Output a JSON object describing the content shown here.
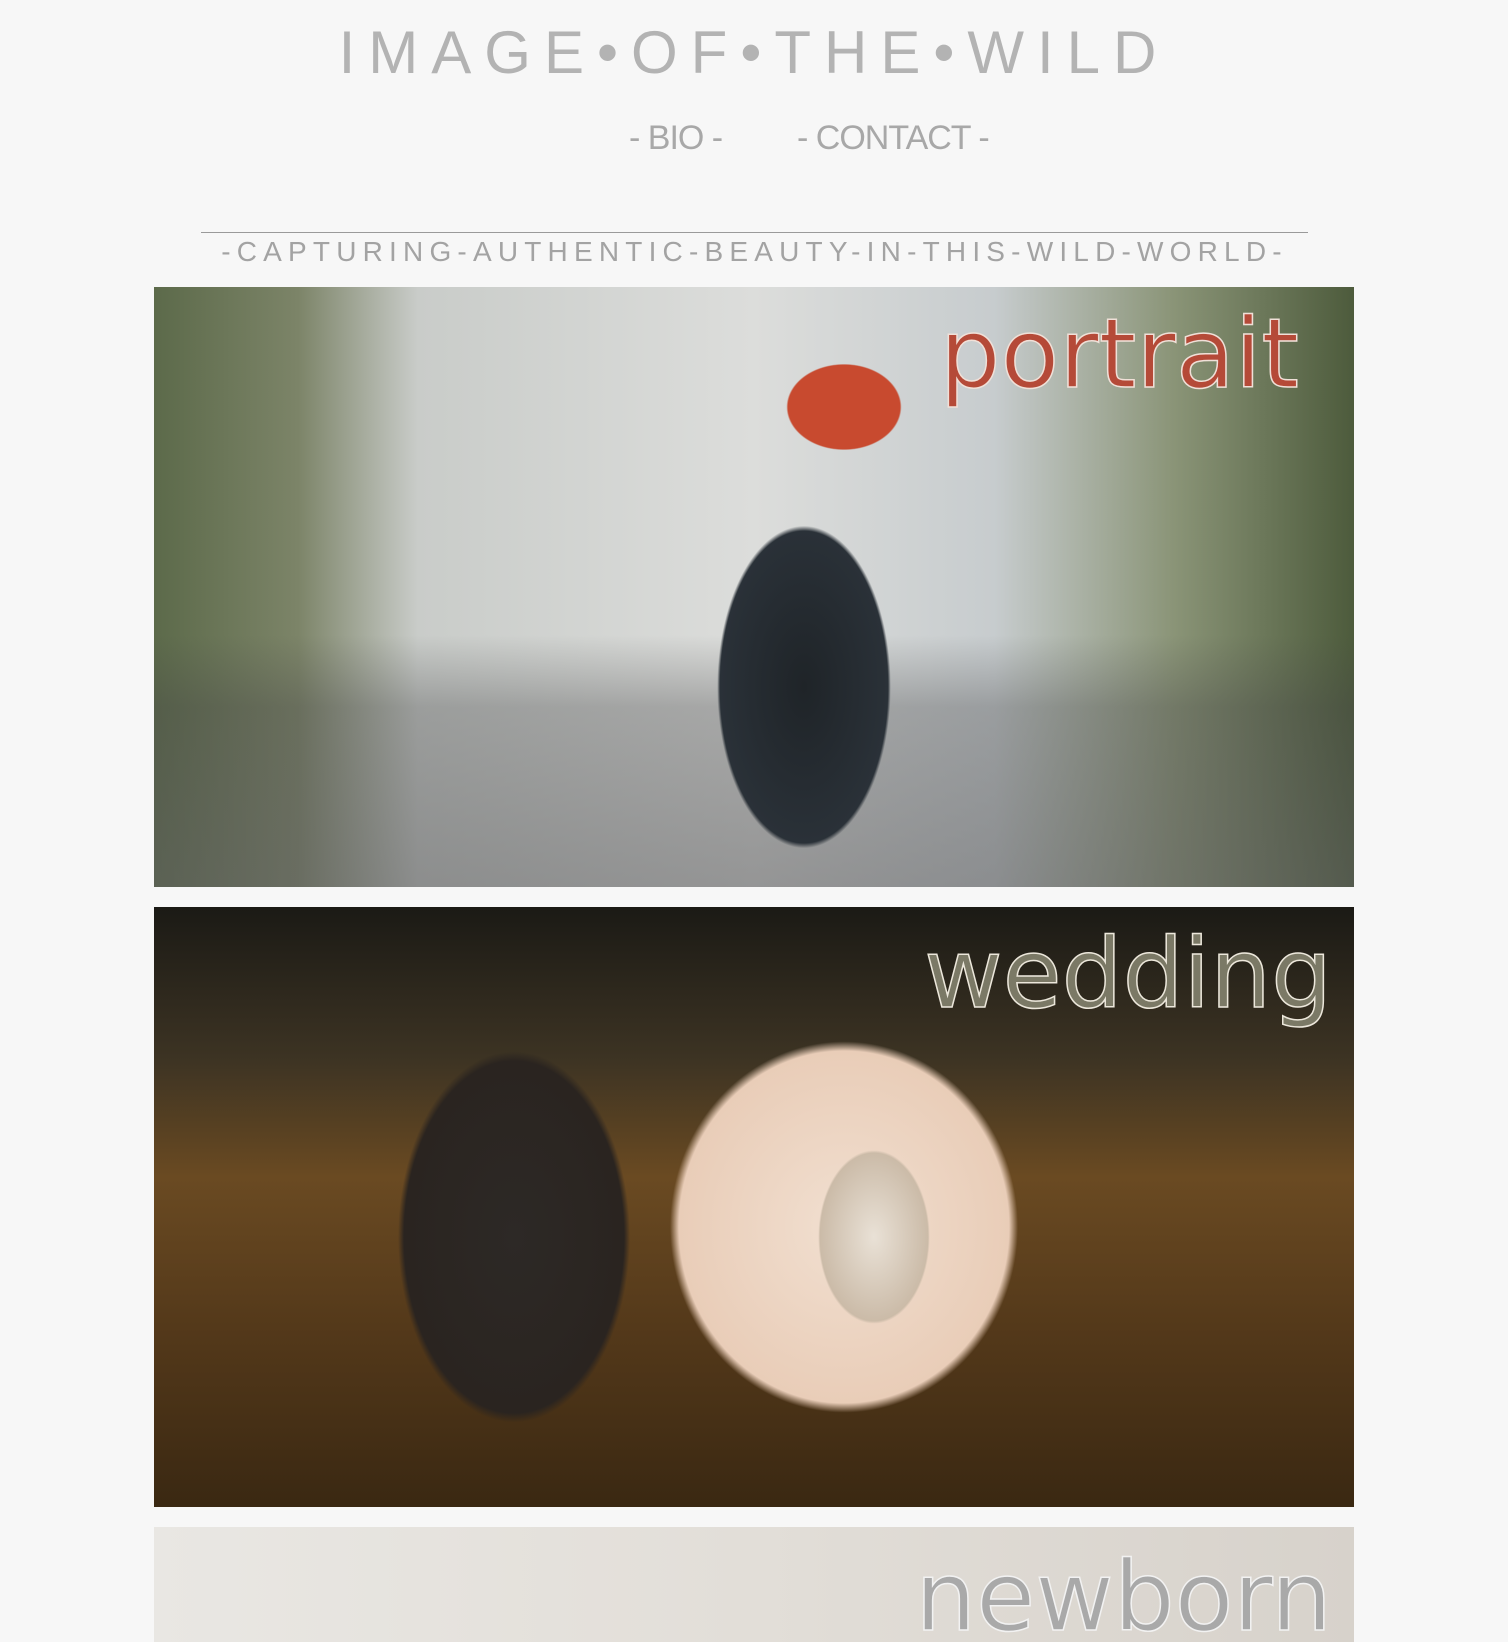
{
  "header": {
    "site_title": "IMAGE•OF•THE•WILD",
    "nav": {
      "bio_label": "- BIO -",
      "contact_label": "- CONTACT -"
    },
    "tagline": "-CAPTURING-AUTHENTIC-BEAUTY-IN-THIS-WILD-WORLD-"
  },
  "gallery": {
    "items": [
      {
        "label": "portrait",
        "label_color": "#b54a38"
      },
      {
        "label": "wedding",
        "label_color": "#7b7966"
      },
      {
        "label": "newborn",
        "label_color": "#a9a9a9"
      }
    ]
  }
}
